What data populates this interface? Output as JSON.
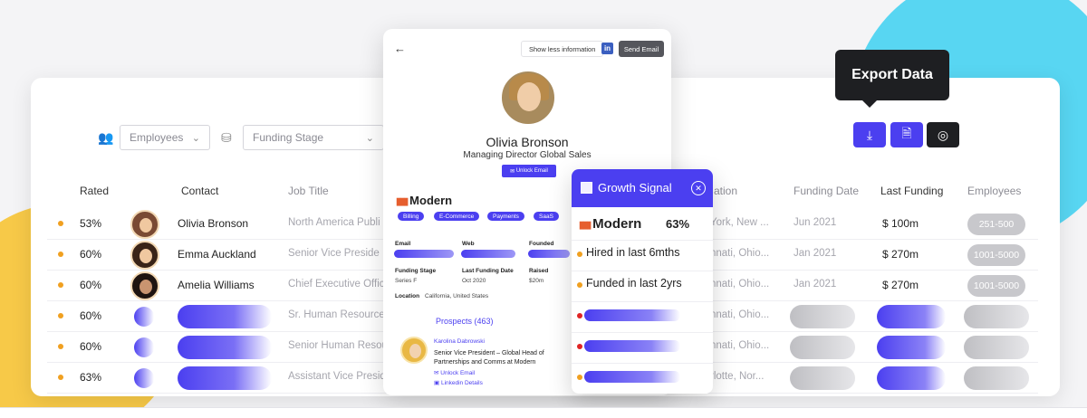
{
  "filters": {
    "employees": "Employees",
    "funding_stage": "Funding Stage"
  },
  "columns": {
    "rated": "Rated",
    "contact": "Contact",
    "job_title": "Job Title",
    "location": "ation",
    "funding_date": "Funding Date",
    "last_funding": "Last Funding",
    "employees": "Employees"
  },
  "rows": [
    {
      "pct": "53%",
      "name": "Olivia Bronson",
      "job": "North America Publi",
      "loc": "York, New ...",
      "fdate": "Jun 2021",
      "lfund": "$ 100m",
      "emp": "251-500"
    },
    {
      "pct": "60%",
      "name": "Emma Auckland",
      "job": "Senior Vice Preside",
      "loc": "nnati, Ohio...",
      "fdate": "Jan 2021",
      "lfund": "$ 270m",
      "emp": "1001-5000"
    },
    {
      "pct": "60%",
      "name": "Amelia Williams",
      "job": "Chief Executive Offic",
      "loc": "nnati, Ohio...",
      "fdate": "Jan 2021",
      "lfund": "$ 270m",
      "emp": "1001-5000"
    },
    {
      "pct": "60%",
      "job": "Sr. Human Resource",
      "loc": "nnati, Ohio..."
    },
    {
      "pct": "60%",
      "job": "Senior Human Resou",
      "loc": "nnati, Ohio..."
    },
    {
      "pct": "63%",
      "job": "Assistant Vice Presid",
      "loc": "rlotte, Nor..."
    }
  ],
  "export": {
    "tooltip": "Export Data",
    "download_icon": "download-icon",
    "file_export_icon": "file-export-icon",
    "explore_icon": "compass-icon"
  },
  "profile": {
    "show_less": "Show less information",
    "send_email": "Send Email",
    "name": "Olivia Bronson",
    "title": "Managing Director Global Sales",
    "unlock_email": "Unlock Email",
    "company": "Modern",
    "tags": [
      "Billing",
      "E-Commerce",
      "Payments",
      "SaaS"
    ],
    "labels": {
      "email": "Email",
      "web": "Web",
      "founded": "Founded",
      "funding_stage": "Funding Stage",
      "last_funding_date": "Last Funding Date",
      "raised": "Raised",
      "location": "Location"
    },
    "values": {
      "funding_stage": "Series F",
      "last_funding_date": "Oct 2020",
      "raised": "$20m",
      "location": "California, United States"
    },
    "prospects": "Prospects (463)",
    "prospect": {
      "name": "Karolina Dabrowski",
      "title": "Senior Vice President – Global Head of Partnerships and Comms at Modern",
      "unlock": "Unlock Email",
      "linkedin": "Linkedin Details"
    }
  },
  "growth": {
    "title": "Growth Signal",
    "company": "Modern",
    "score": "63%",
    "signals": [
      "Hired in last 6mths",
      "Funded in last 2yrs"
    ]
  },
  "colors": {
    "accent": "#4b3ff0",
    "dark": "#1e1f22",
    "warning_dot": "#f0a020",
    "alert_dot": "#e02424"
  }
}
